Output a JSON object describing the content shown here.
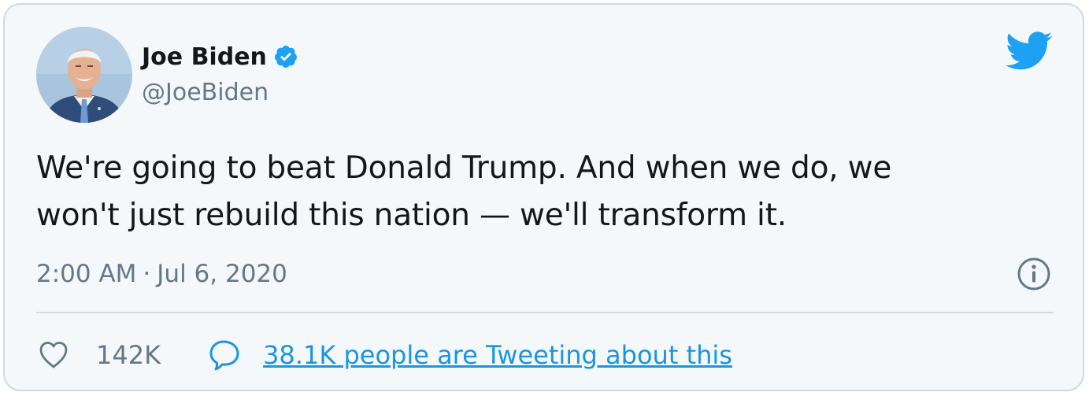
{
  "author": {
    "name": "Joe Biden",
    "handle": "@JoeBiden",
    "verified": true
  },
  "tweet": {
    "text": "We're going to beat Donald Trump. And when we do, we\nwon't just rebuild this nation — we'll transform it.",
    "time": "2:00 AM",
    "separator": "·",
    "date": "Jul 6, 2020"
  },
  "stats": {
    "likes": "142K",
    "tweeting_link": "38.1K people are Tweeting about this"
  },
  "icons": {
    "brand": "twitter-bird-icon",
    "verified": "verified-badge-icon",
    "info": "info-icon",
    "like": "heart-icon",
    "reply": "speech-bubble-icon"
  },
  "colors": {
    "twitter_blue": "#1da1f2",
    "link_blue": "#1b95e0",
    "secondary_text": "#657786",
    "primary_text": "#14171a",
    "card_background": "#f5f8fa",
    "border": "#cfd9de"
  }
}
